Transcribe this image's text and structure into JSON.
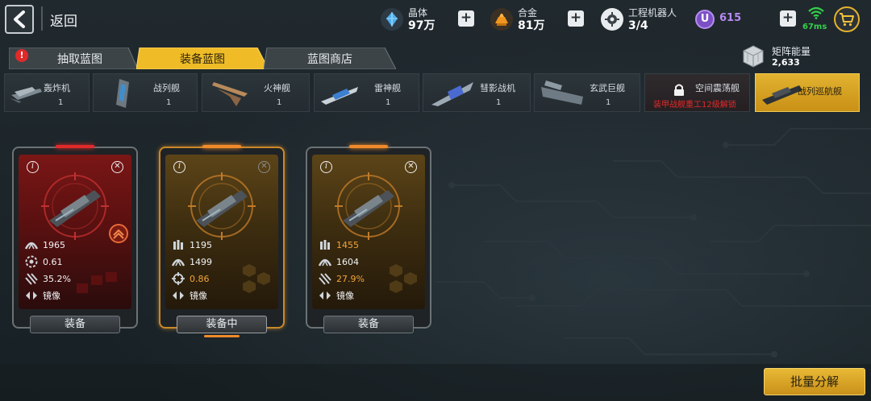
{
  "header": {
    "back_label": "返回",
    "resources": [
      {
        "name": "crystal",
        "label": "晶体",
        "value": "97万",
        "icon": "crystal-icon",
        "color": "#3a9bd9"
      },
      {
        "name": "alloy",
        "label": "合金",
        "value": "81万",
        "icon": "alloy-icon",
        "color": "#e08a1a"
      },
      {
        "name": "robot",
        "label": "工程机器人",
        "value": "3/4",
        "icon": "robot-icon"
      }
    ],
    "premium": {
      "icon": "u-coin-icon",
      "value": "615",
      "color": "#9b6bd6"
    },
    "ping": {
      "value": "67ms",
      "color": "#35d04a"
    }
  },
  "tabs": [
    {
      "label": "抽取蓝图",
      "active": false,
      "alert": "!"
    },
    {
      "label": "装备蓝图",
      "active": true
    },
    {
      "label": "蓝图商店",
      "active": false
    }
  ],
  "matrix_energy": {
    "label": "矩阵能量",
    "value": "2,633"
  },
  "ship_types": [
    {
      "name": "轰炸机",
      "count": "1"
    },
    {
      "name": "战列舰",
      "count": "1"
    },
    {
      "name": "火神舰",
      "count": "1"
    },
    {
      "name": "雷神舰",
      "count": "1"
    },
    {
      "name": "彗影战机",
      "count": "1"
    },
    {
      "name": "玄武巨舰",
      "count": "1"
    },
    {
      "name": "空间震荡舰",
      "locked_text": "装甲战舰重工12级解锁"
    },
    {
      "name": "战列巡航舰",
      "selected": true
    }
  ],
  "cards": [
    {
      "theme": "red",
      "stats": [
        {
          "icon": "attack-icon",
          "value": "1965"
        },
        {
          "icon": "accuracy-ring-icon",
          "value": "0.61"
        },
        {
          "icon": "crit-icon",
          "value": "35.2%"
        },
        {
          "icon": "mirror-icon",
          "value": "镜像"
        }
      ],
      "button": "装备"
    },
    {
      "theme": "orange",
      "stats": [
        {
          "icon": "ammo-icon",
          "value": "1195"
        },
        {
          "icon": "attack-icon",
          "value": "1499"
        },
        {
          "icon": "crosshair-icon",
          "value": "0.86",
          "highlight": true
        },
        {
          "icon": "mirror-icon",
          "value": "镜像"
        }
      ],
      "button": "装备中"
    },
    {
      "theme": "orange",
      "stats": [
        {
          "icon": "ammo-icon",
          "value": "1455",
          "highlight": true
        },
        {
          "icon": "attack-icon",
          "value": "1604"
        },
        {
          "icon": "crit-icon",
          "value": "27.9%",
          "highlight": true
        },
        {
          "icon": "mirror-icon",
          "value": "镜像"
        }
      ],
      "button": "装备"
    }
  ],
  "footer": {
    "batch_button": "批量分解"
  }
}
